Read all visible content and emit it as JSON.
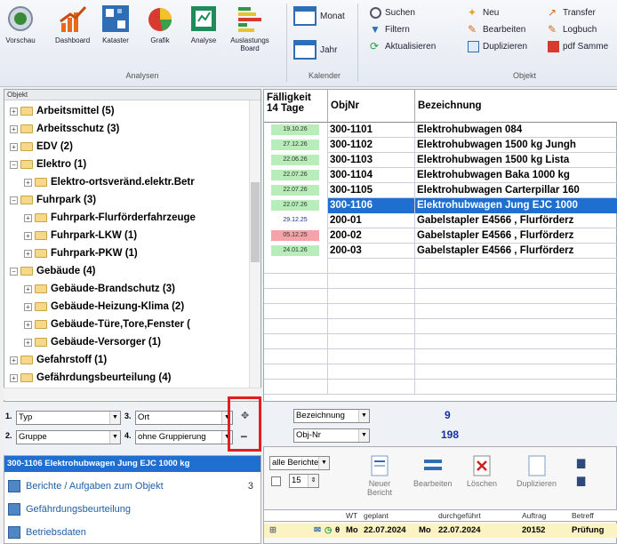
{
  "ribbon": {
    "big_buttons": [
      {
        "label": "Vorschau",
        "icon": "preview-icon"
      },
      {
        "label": "Dashboard",
        "icon": "dashboard-icon"
      },
      {
        "label": "Kataster",
        "icon": "cadastre-icon"
      },
      {
        "label": "Grafik",
        "icon": "pie-chart-icon"
      },
      {
        "label": "Analyse",
        "icon": "analysis-icon"
      },
      {
        "label": "Auslastungs Board",
        "icon": "load-board-icon"
      }
    ],
    "group_analysen": "Analysen",
    "kalender": {
      "monat": "Monat",
      "jahr": "Jahr",
      "group": "Kalender"
    },
    "search": {
      "suchen": "Suchen",
      "filtern": "Filtern",
      "aktualisieren": "Aktualisieren"
    },
    "objekt": {
      "neu": "Neu",
      "bearbeiten": "Bearbeiten",
      "duplizieren": "Duplizieren",
      "transfer": "Transfer",
      "logbuch": "Logbuch",
      "pdf": "pdf Samme",
      "group": "Objekt"
    }
  },
  "tree": {
    "header": "Objekt",
    "items": [
      {
        "label": "Arbeitsmittel (5)",
        "level": 0,
        "exp": "+"
      },
      {
        "label": "Arbeitsschutz (3)",
        "level": 0,
        "exp": "+"
      },
      {
        "label": "EDV (2)",
        "level": 0,
        "exp": "+"
      },
      {
        "label": "Elektro (1)",
        "level": 0,
        "exp": "−"
      },
      {
        "label": "Elektro-ortsveränd.elektr.Betr",
        "level": 1,
        "exp": "+"
      },
      {
        "label": "Fuhrpark (3)",
        "level": 0,
        "exp": "−"
      },
      {
        "label": "Fuhrpark-Flurförderfahrzeuge",
        "level": 1,
        "exp": "+"
      },
      {
        "label": "Fuhrpark-LKW (1)",
        "level": 1,
        "exp": "+"
      },
      {
        "label": "Fuhrpark-PKW (1)",
        "level": 1,
        "exp": "+"
      },
      {
        "label": "Gebäude (4)",
        "level": 0,
        "exp": "−"
      },
      {
        "label": "Gebäude-Brandschutz (3)",
        "level": 1,
        "exp": "+"
      },
      {
        "label": "Gebäude-Heizung-Klima (2)",
        "level": 1,
        "exp": "+"
      },
      {
        "label": "Gebäude-Türe,Tore,Fenster (",
        "level": 1,
        "exp": "+"
      },
      {
        "label": "Gebäude-Versorger (1)",
        "level": 1,
        "exp": "+"
      },
      {
        "label": "Gefahrstoff (1)",
        "level": 0,
        "exp": "+"
      },
      {
        "label": "Gefährdungsbeurteilung (4)",
        "level": 0,
        "exp": "+"
      }
    ]
  },
  "grid": {
    "headers": {
      "faelligkeit": "Fälligkeit 14 Tage",
      "objnr": "ObjNr",
      "bez": "Bezeichnung"
    },
    "rows": [
      {
        "date": "19.10.26",
        "color": "#b8ecb8",
        "objnr": "300-1101",
        "bez": "Elektrohubwagen 084"
      },
      {
        "date": "27.12.26",
        "color": "#b8ecb8",
        "objnr": "300-1102",
        "bez": "Elektrohubwagen 1500 kg  Jungh"
      },
      {
        "date": "22.06.26",
        "color": "#b8ecb8",
        "objnr": "300-1103",
        "bez": "Elektrohubwagen 1500 kg Lista"
      },
      {
        "date": "22.07.26",
        "color": "#b8ecb8",
        "objnr": "300-1104",
        "bez": "Elektrohubwagen Baka 1000 kg"
      },
      {
        "date": "22.07.26",
        "color": "#b8ecb8",
        "objnr": "300-1105",
        "bez": "Elektrohubwagen Carterpillar 160"
      },
      {
        "date": "22.07.26",
        "color": "#b8ecb8",
        "objnr": "300-1106",
        "bez": "Elektrohubwagen Jung EJC 1000"
      },
      {
        "date": "29.12.25",
        "color": "#ffffff",
        "objnr": "200-01",
        "bez": "Gabelstapler E4566 , Flurförderz"
      },
      {
        "date": "05.12.25",
        "color": "#f4a3a8",
        "objnr": "200-02",
        "bez": "Gabelstapler E4566 , Flurförderz"
      },
      {
        "date": "24.01.26",
        "color": "#b8ecb8",
        "objnr": "200-03",
        "bez": "Gabelstapler E4566 , Flurförderz"
      }
    ],
    "selected_index": 5
  },
  "filter": {
    "n1": "1.",
    "c1": "Typ",
    "n2": "2.",
    "c2": "Gruppe",
    "n3": "3.",
    "c3": "Ort",
    "n4": "4.",
    "c4": "ohne Gruppierung",
    "sort1": "Bezeichnung",
    "sort2": "Obj-Nr",
    "count1": "9",
    "count2": "198"
  },
  "selected_object": "300-1106 Elektrohubwagen Jung EJC 1000 kg",
  "object_links": [
    {
      "label": "Berichte / Aufgaben zum Objekt",
      "count": "3"
    },
    {
      "label": "Gefährdungsbeurteilung",
      "count": ""
    },
    {
      "label": "Betriebsdaten",
      "count": ""
    }
  ],
  "reports": {
    "filter": "alle Berichte",
    "spin": "15",
    "buttons": [
      "Neuer Bericht",
      "Bearbeiten",
      "Löschen",
      "Duplizieren"
    ],
    "cols": [
      "WT",
      "geplant",
      "durchgeführt",
      "Auftrag",
      "Betreff"
    ],
    "row": {
      "wt": "Mo",
      "geplant": "22.07.2024",
      "wt2": "Mo",
      "durch": "22.07.2024",
      "auftrag": "20152",
      "betreff": "Prüfung"
    }
  }
}
